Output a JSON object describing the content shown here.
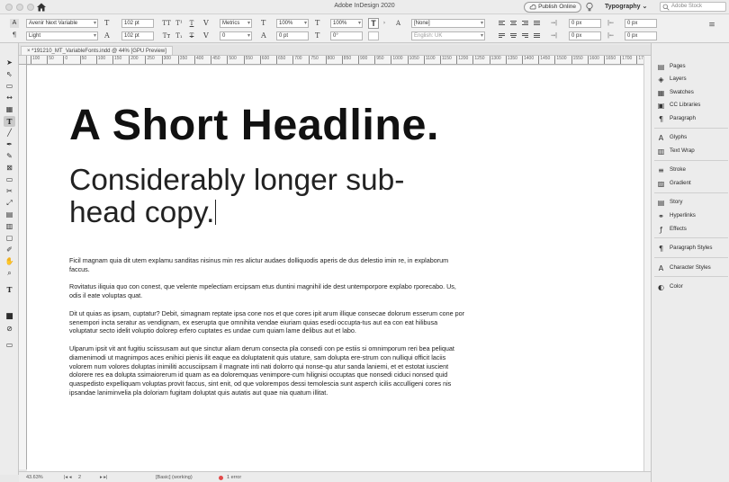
{
  "titlebar": {
    "app_title": "Adobe InDesign 2020",
    "publish_label": "Publish Online",
    "workspace": "Typography",
    "workspace_chevron": "⌄",
    "stock_placeholder": "Adobe Stock"
  },
  "control": {
    "font_family": "Avenir Next Variable",
    "font_style": "Light",
    "font_size": "102 pt",
    "leading": "102 pt",
    "kerning": "Metrics",
    "tracking": "0",
    "vscale": "100%",
    "hscale": "100%",
    "baseline": "0 pt",
    "skew": "0°",
    "char_style": "[None]",
    "language": "English: UK",
    "indent_1": "0 px",
    "indent_2": "0 px",
    "indent_3": "0 px",
    "indent_4": "0 px",
    "glyph_A": "A",
    "glyph_para": "¶"
  },
  "document": {
    "tab_label": "*191210_MT_VariableFonts.indd @ 44% [GPU Preview]",
    "headline": "A Short Headline.",
    "subhead": "Considerably longer sub-head copy.",
    "paragraphs": [
      "Ficil magnam quia dit utem explamu sanditas nisinus min res alictur audaes dolliquodis aperis de dus delestio imin re, in explaborum faccus.",
      "Rovitatus iliquia quo con conest, que velente mpelectiam ercipsam etus duntini magnihil ide dest untemporpore explabo rporecabo. Us, odis il eate voluptas quat.",
      "Dit ut quias as ipsam, cuptatur? Debit, simagnam reptate ipsa cone nos et que cores ipit arum illique consecae dolorum esserum cone por senempori incta seratur as vendignam, ex eserupta que omnihita vendae eiuriam quias esedi occupta-tus aut ea con eat hilibusa voluptatur secto idelit voluptio dolorep erfero cuptates es undae cum quiam lame delibus aut et labo.",
      "Ulparum ipsit vit ant fugitiu sciissusam aut que sinctur aliam derum consecta pla consedi con pe estiis si omnimporum reri bea peliquat diamenimodi ut magnimpos aces enihici pienis ilit eaque ea doluptatenit quis utature, sam dolupta ere-strum con nulliqui officit laciis volorem num volores doluptas inimiliti accusciipsam il magnate inti nati dolorro qui nonse-qu atur sanda laniemi, et et estotat iuscient dolorere res ea dolupta ssimaiorerum id quam as ea doloremquas venimpore-cum hilignisi occuptas que nonsedi ciduci nonsed quid quaspedisto expelliquam voluptas provit faccus, sint enit, od que volorempos dessi temolescia sunt asperch icilis acculligeni cores nis ipsandae laniminvelia pla doloriam fugitam doluptat quis autatis aut quae nia quatum illitat."
    ]
  },
  "ruler_ticks": [
    "100",
    "50",
    "0",
    "50",
    "100",
    "150",
    "200",
    "250",
    "300",
    "350",
    "400",
    "450",
    "500",
    "550",
    "600",
    "650",
    "700",
    "750",
    "800",
    "850",
    "900",
    "950",
    "1000",
    "1050",
    "1100",
    "1150",
    "1200",
    "1250",
    "1300",
    "1350",
    "1400",
    "1450",
    "1500",
    "1550",
    "1600",
    "1650",
    "1700",
    "1750"
  ],
  "statusbar": {
    "zoom": "43.63%",
    "page": "2",
    "preflight_profile": "[Basic] (working)",
    "errors": "1 error"
  },
  "panels": [
    {
      "label": "Pages",
      "icon": "pages-icon",
      "glyph": "▤"
    },
    {
      "label": "Layers",
      "icon": "layers-icon",
      "glyph": "◈"
    },
    {
      "label": "Swatches",
      "icon": "swatches-icon",
      "glyph": "▦"
    },
    {
      "label": "CC Libraries",
      "icon": "cc-libraries-icon",
      "glyph": "▣"
    },
    {
      "label": "Paragraph",
      "icon": "paragraph-icon",
      "glyph": "¶"
    },
    {
      "label": "Glyphs",
      "icon": "glyphs-icon",
      "glyph": "A"
    },
    {
      "label": "Text Wrap",
      "icon": "text-wrap-icon",
      "glyph": "▥"
    },
    {
      "label": "Stroke",
      "icon": "stroke-icon",
      "glyph": "≡"
    },
    {
      "label": "Gradient",
      "icon": "gradient-icon",
      "glyph": "▨"
    },
    {
      "label": "Story",
      "icon": "story-icon",
      "glyph": "▤"
    },
    {
      "label": "Hyperlinks",
      "icon": "hyperlinks-icon",
      "glyph": "⚭"
    },
    {
      "label": "Effects",
      "icon": "effects-icon",
      "glyph": "ƒ"
    },
    {
      "label": "Paragraph Styles",
      "icon": "paragraph-styles-icon",
      "glyph": "¶"
    },
    {
      "label": "Character Styles",
      "icon": "character-styles-icon",
      "glyph": "A"
    },
    {
      "label": "Color",
      "icon": "color-icon",
      "glyph": "◐"
    }
  ],
  "colors": {
    "error": "#e24a4a",
    "accent": "#111111"
  }
}
